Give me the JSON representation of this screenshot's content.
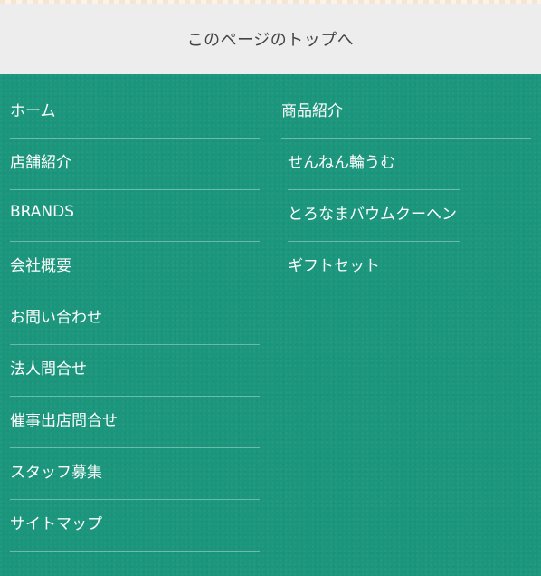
{
  "page_top": {
    "label": "このページのトップへ"
  },
  "footer_nav": {
    "left_items": [
      "ホーム",
      "店舗紹介",
      "BRANDS",
      "会社概要",
      "お問い合わせ",
      "法人問合せ",
      "催事出店問合せ",
      "スタッフ募集",
      "サイトマップ"
    ],
    "products": {
      "heading": "商品紹介",
      "items": [
        "せんねん輪うむ",
        "とろなまバウムクーヘン",
        "ギフトセット"
      ]
    }
  },
  "colors": {
    "footer_bg": "#1b967c",
    "page_top_bg": "#ededed",
    "page_top_text": "#444444",
    "nav_text": "#ffffff"
  }
}
